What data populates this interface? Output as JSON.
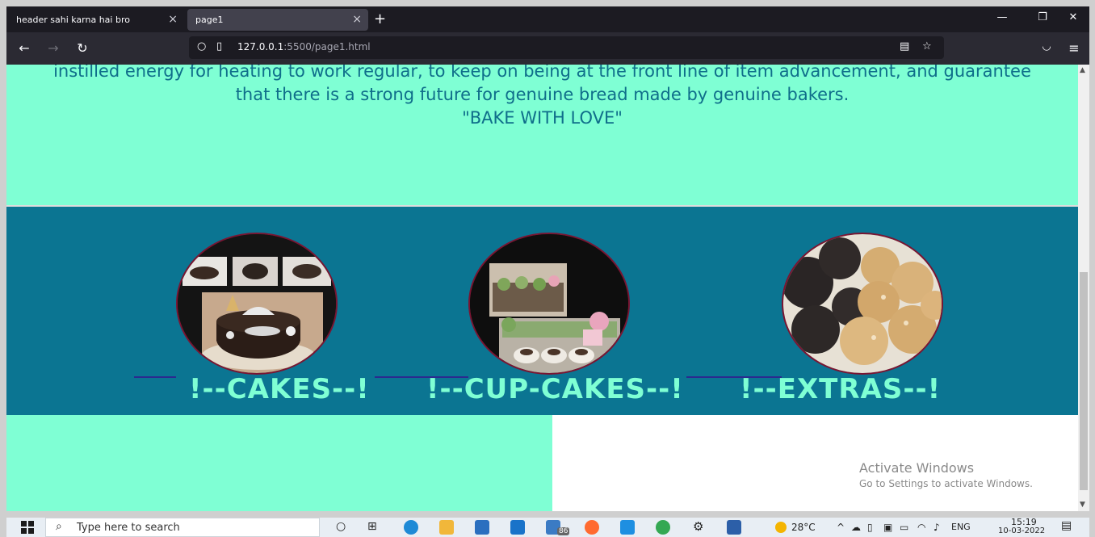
{
  "browser": {
    "tabs": [
      {
        "label": "header sahi karna hai bro",
        "close": "×"
      },
      {
        "label": "page1",
        "close": "×"
      }
    ],
    "new_tab": "+",
    "url_host": "127.0.0.1",
    "url_rest": ":5500/page1.html",
    "window_controls": {
      "minimize": "—",
      "restore": "❐",
      "close": "✕"
    }
  },
  "intro": {
    "line1": "instilled energy for heating to work regular, to keep on being at the front line of item advancement, and guarantee",
    "line2": "that there is a strong future for genuine bread made by genuine bakers.",
    "line3": "\"BAKE WITH LOVE\""
  },
  "gallery": {
    "items": [
      {
        "caption": "!--CAKES--!",
        "image": "cakes-photo"
      },
      {
        "caption": "!--CUP-CAKES--!",
        "image": "cupcakes-photo"
      },
      {
        "caption": "!--EXTRAS--!",
        "image": "cookies-photo"
      }
    ]
  },
  "watermark": {
    "title": "Activate Windows",
    "subtitle": "Go to Settings to activate Windows."
  },
  "taskbar": {
    "search_placeholder": "Type here to search",
    "weather": "28°C",
    "language": "ENG",
    "time": "15:19",
    "date": "10-03-2022",
    "badge": "86"
  },
  "colors": {
    "aquamarine": "#7fffd4",
    "teal": "#0b7592",
    "text": "#0f6e8a"
  }
}
